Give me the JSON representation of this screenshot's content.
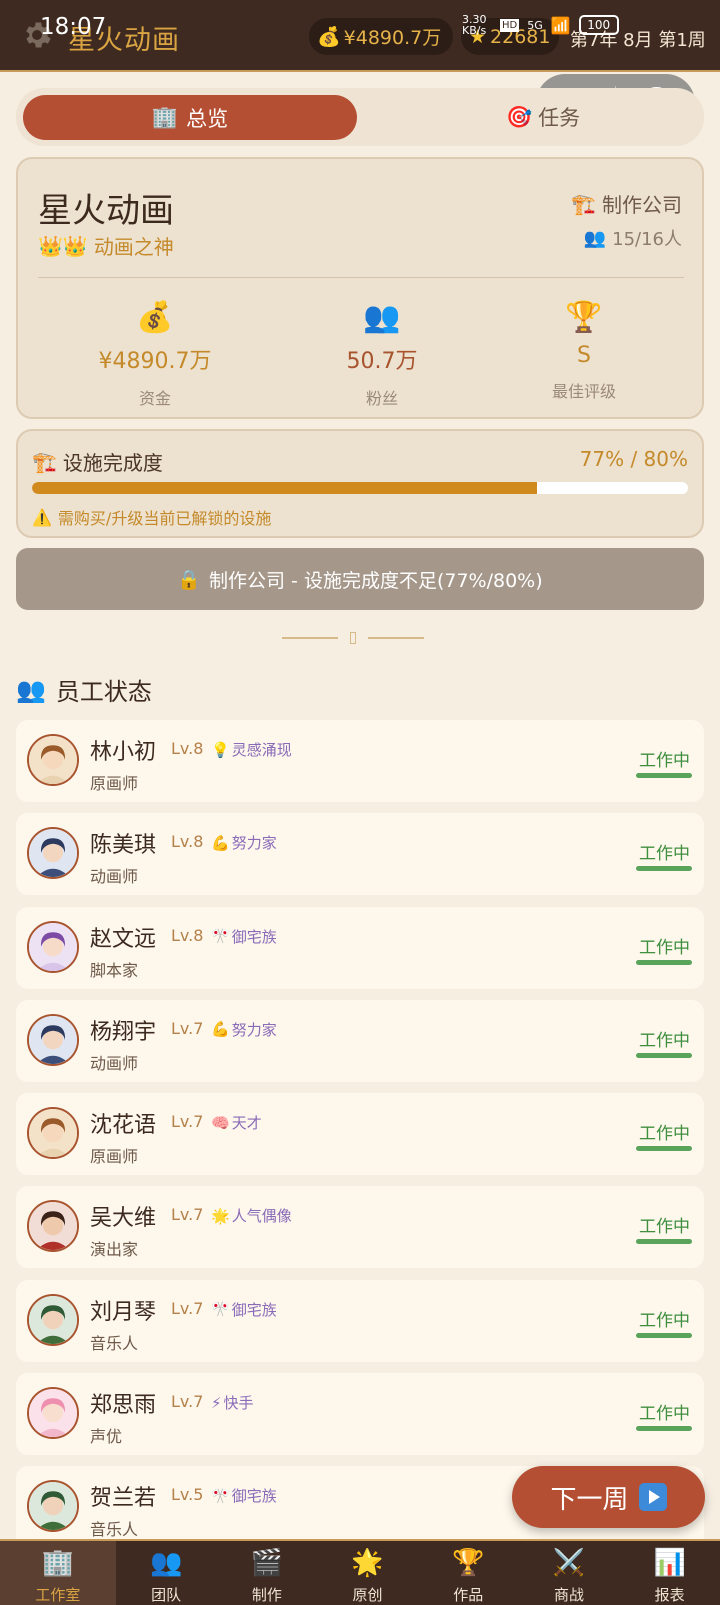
{
  "status_bar": {
    "time": "18:07",
    "net_speed": "3.30 KB/s",
    "signal": "5G",
    "battery": "100"
  },
  "header": {
    "app_name": "星火动画",
    "money": "¥4890.7万",
    "stars": "22681",
    "date": "第7年 8月 第1周"
  },
  "tabs": [
    {
      "label": "总览",
      "icon": "building-icon",
      "active": true
    },
    {
      "label": "任务",
      "icon": "target-icon",
      "active": false
    }
  ],
  "company": {
    "name": "星火动画",
    "title": "动画之神",
    "type": "制作公司",
    "staff": "15/16人",
    "stats": [
      {
        "value": "¥4890.7万",
        "label": "资金",
        "color": "#c48a2a",
        "icon": "money-bag-icon"
      },
      {
        "value": "50.7万",
        "label": "粉丝",
        "color": "#a8542f",
        "icon": "fans-icon"
      },
      {
        "value": "S",
        "label": "最佳评级",
        "color": "#c48a2a",
        "icon": "trophy-icon"
      }
    ]
  },
  "facility": {
    "title": "设施完成度",
    "progress_text": "77% / 80%",
    "progress": 0.77,
    "warning": "需购买/升级当前已解锁的设施"
  },
  "lock_banner": "制作公司 - 设施完成度不足(77%/80%)",
  "employee_section_title": "员工状态",
  "employees": [
    {
      "name": "林小初",
      "level": "Lv.8",
      "trait_icon": "💡",
      "trait": "灵感涌现",
      "role": "原画师",
      "status": "工作中",
      "avatar": "brown-hair"
    },
    {
      "name": "陈美琪",
      "level": "Lv.8",
      "trait_icon": "💪",
      "trait": "努力家",
      "role": "动画师",
      "status": "工作中",
      "avatar": "blue-glasses"
    },
    {
      "name": "赵文远",
      "level": "Lv.8",
      "trait_icon": "🎌",
      "trait": "御宅族",
      "role": "脚本家",
      "status": "工作中",
      "avatar": "purple-hair"
    },
    {
      "name": "杨翔宇",
      "level": "Lv.7",
      "trait_icon": "💪",
      "trait": "努力家",
      "role": "动画师",
      "status": "工作中",
      "avatar": "blue-glasses"
    },
    {
      "name": "沈花语",
      "level": "Lv.7",
      "trait_icon": "🧠",
      "trait": "天才",
      "role": "原画师",
      "status": "工作中",
      "avatar": "brown-hair"
    },
    {
      "name": "吴大维",
      "level": "Lv.7",
      "trait_icon": "🌟",
      "trait": "人气偶像",
      "role": "演出家",
      "status": "工作中",
      "avatar": "red-suit"
    },
    {
      "name": "刘月琴",
      "level": "Lv.7",
      "trait_icon": "🎌",
      "trait": "御宅族",
      "role": "音乐人",
      "status": "工作中",
      "avatar": "green-hair"
    },
    {
      "name": "郑思雨",
      "level": "Lv.7",
      "trait_icon": "⚡",
      "trait": "快手",
      "role": "声优",
      "status": "工作中",
      "avatar": "pink-hair"
    },
    {
      "name": "贺兰若",
      "level": "Lv.5",
      "trait_icon": "🎌",
      "trait": "御宅族",
      "role": "音乐人",
      "status": "",
      "avatar": "green-hair"
    }
  ],
  "next_week_label": "下一周",
  "bottom_nav": [
    {
      "label": "工作室",
      "icon": "building-icon",
      "active": true
    },
    {
      "label": "团队",
      "icon": "team-icon",
      "active": false
    },
    {
      "label": "制作",
      "icon": "clapper-icon",
      "active": false
    },
    {
      "label": "原创",
      "icon": "sparkle-icon",
      "active": false
    },
    {
      "label": "作品",
      "icon": "trophy-icon",
      "active": false
    },
    {
      "label": "商战",
      "icon": "swords-icon",
      "active": false
    },
    {
      "label": "报表",
      "icon": "chart-icon",
      "active": false
    }
  ]
}
